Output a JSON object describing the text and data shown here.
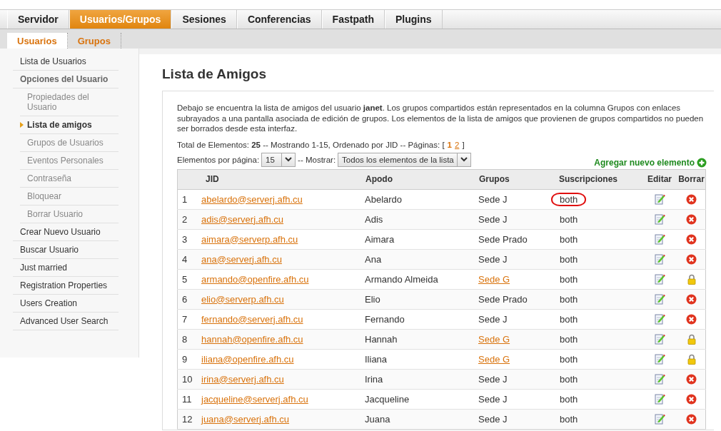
{
  "main_tabs": [
    {
      "label": "Servidor",
      "selected": false
    },
    {
      "label": "Usuarios/Grupos",
      "selected": true
    },
    {
      "label": "Sesiones",
      "selected": false
    },
    {
      "label": "Conferencias",
      "selected": false
    },
    {
      "label": "Fastpath",
      "selected": false
    },
    {
      "label": "Plugins",
      "selected": false
    }
  ],
  "sub_tabs": [
    {
      "label": "Usuarios",
      "selected": true
    },
    {
      "label": "Grupos",
      "selected": false
    }
  ],
  "sidebar": {
    "items": [
      {
        "label": "Lista de Usuarios",
        "selected": false
      },
      {
        "label": "Opciones del Usuario",
        "selected": false,
        "kind": "heading",
        "children": [
          {
            "label": "Propiedades del Usuario",
            "selected": false
          },
          {
            "label": "Lista de amigos",
            "selected": true
          },
          {
            "label": "Grupos de Usuarios",
            "selected": false
          },
          {
            "label": "Eventos Personales",
            "selected": false
          },
          {
            "label": "Contraseña",
            "selected": false
          },
          {
            "label": "Bloquear",
            "selected": false
          },
          {
            "label": "Borrar Usuario",
            "selected": false
          }
        ]
      },
      {
        "label": "Crear Nuevo Usuario",
        "selected": false
      },
      {
        "label": "Buscar Usuario",
        "selected": false
      },
      {
        "label": "Just married",
        "selected": false
      },
      {
        "label": "Registration Properties",
        "selected": false
      },
      {
        "label": "Users Creation",
        "selected": false
      },
      {
        "label": "Advanced User Search",
        "selected": false
      }
    ]
  },
  "page_title": "Lista de Amigos",
  "description": "Debajo se encuentra la lista de amigos del usuario **janet**. Los grupos compartidos están representados en la columna Grupos con enlaces subrayados a una pantalla asociada de edición de grupos. Los elementos de la lista de amigos que provienen de grupos compartidos no pueden ser borrados desde esta interfaz.",
  "summary": {
    "prefix": "Total de Elementos: **25** -- Mostrando 1-15, Ordenado por JID -- Páginas: [",
    "pages": [
      {
        "label": "1",
        "selected": true
      },
      {
        "label": "2",
        "selected": false
      }
    ],
    "suffix": "]"
  },
  "per_page": {
    "label": "Elementos por página:",
    "value": "15"
  },
  "filter": {
    "label": "-- Mostrar:",
    "value": "Todos los elementos de la lista"
  },
  "add_link": "Agregar nuevo elemento",
  "table": {
    "columns": [
      "JID",
      "Apodo",
      "Grupos",
      "Suscripciones",
      "Editar",
      "Borrar"
    ],
    "rows": [
      {
        "index": "1",
        "jid": "abelardo@serverj.afh.cu",
        "nick": "Abelardo",
        "group": "Sede J",
        "group_linked": false,
        "subscription": "both",
        "circled": true,
        "locked": false
      },
      {
        "index": "2",
        "jid": "adis@serverj.afh.cu",
        "nick": "Adis",
        "group": "Sede J",
        "group_linked": false,
        "subscription": "both",
        "circled": false,
        "locked": false
      },
      {
        "index": "3",
        "jid": "aimara@serverp.afh.cu",
        "nick": "Aimara",
        "group": "Sede Prado",
        "group_linked": false,
        "subscription": "both",
        "circled": false,
        "locked": false
      },
      {
        "index": "4",
        "jid": "ana@serverj.afh.cu",
        "nick": "Ana",
        "group": "Sede J",
        "group_linked": false,
        "subscription": "both",
        "circled": false,
        "locked": false
      },
      {
        "index": "5",
        "jid": "armando@openfire.afh.cu",
        "nick": "Armando Almeida",
        "group": "Sede G",
        "group_linked": true,
        "subscription": "both",
        "circled": false,
        "locked": true
      },
      {
        "index": "6",
        "jid": "elio@serverp.afh.cu",
        "nick": "Elio",
        "group": "Sede Prado",
        "group_linked": false,
        "subscription": "both",
        "circled": false,
        "locked": false
      },
      {
        "index": "7",
        "jid": "fernando@serverj.afh.cu",
        "nick": "Fernando",
        "group": "Sede J",
        "group_linked": false,
        "subscription": "both",
        "circled": false,
        "locked": false
      },
      {
        "index": "8",
        "jid": "hannah@openfire.afh.cu",
        "nick": "Hannah",
        "group": "Sede G",
        "group_linked": true,
        "subscription": "both",
        "circled": false,
        "locked": true
      },
      {
        "index": "9",
        "jid": "iliana@openfire.afh.cu",
        "nick": "Iliana",
        "group": "Sede G",
        "group_linked": true,
        "subscription": "both",
        "circled": false,
        "locked": true
      },
      {
        "index": "10",
        "jid": "irina@serverj.afh.cu",
        "nick": "Irina",
        "group": "Sede J",
        "group_linked": false,
        "subscription": "both",
        "circled": false,
        "locked": false
      },
      {
        "index": "11",
        "jid": "jacqueline@serverj.afh.cu",
        "nick": "Jacqueline",
        "group": "Sede J",
        "group_linked": false,
        "subscription": "both",
        "circled": false,
        "locked": false
      },
      {
        "index": "12",
        "jid": "juana@serverj.afh.cu",
        "nick": "Juana",
        "group": "Sede J",
        "group_linked": false,
        "subscription": "both",
        "circled": false,
        "locked": false
      }
    ]
  }
}
